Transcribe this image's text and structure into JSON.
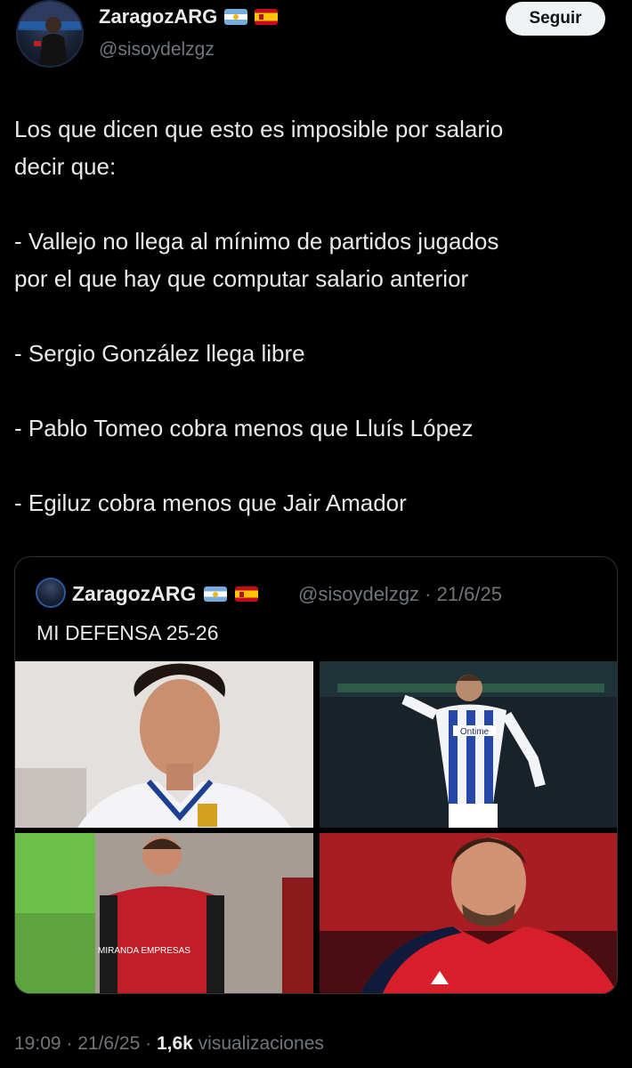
{
  "author": {
    "name": "ZaragozARG",
    "handle": "@sisoydelzgz",
    "flags": [
      "argentina-flag",
      "spain-flag"
    ]
  },
  "follow_button": {
    "label": "Seguir"
  },
  "tweet": {
    "lines": [
      "Los que dicen que esto es imposible por salario",
      "decir que:",
      "",
      "- Vallejo no llega al mínimo de partidos jugados",
      "por el que hay que computar salario anterior",
      "",
      "- Sergio González llega libre",
      "",
      "- Pablo Tomeo cobra menos que Lluís López",
      "",
      "- Egiluz cobra menos que Jair Amador"
    ]
  },
  "quote": {
    "author_name": "ZaragozARG",
    "handle_date": "@sisoydelzgz · 21/6/25",
    "text": "MI DEFENSA 25-26",
    "photos": [
      {
        "name": "player-photo-zaragoza-white-kit",
        "sponsor": ""
      },
      {
        "name": "player-photo-leganes-ontime-kit",
        "sponsor": "Ontime"
      },
      {
        "name": "player-photo-mirandes-red-kit",
        "sponsor": "MIRANDA EMPRESAS"
      },
      {
        "name": "player-photo-osasuna-red-kit",
        "sponsor": ""
      }
    ]
  },
  "meta": {
    "time_date": "19:09 · 21/6/25 · ",
    "views_count": "1,6k",
    "views_label": " visualizaciones"
  },
  "colors": {
    "background": "#000000",
    "text_primary": "#e7e9ea",
    "text_secondary": "#71767b",
    "border": "#2f3336",
    "button_bg": "#eff3f4"
  }
}
